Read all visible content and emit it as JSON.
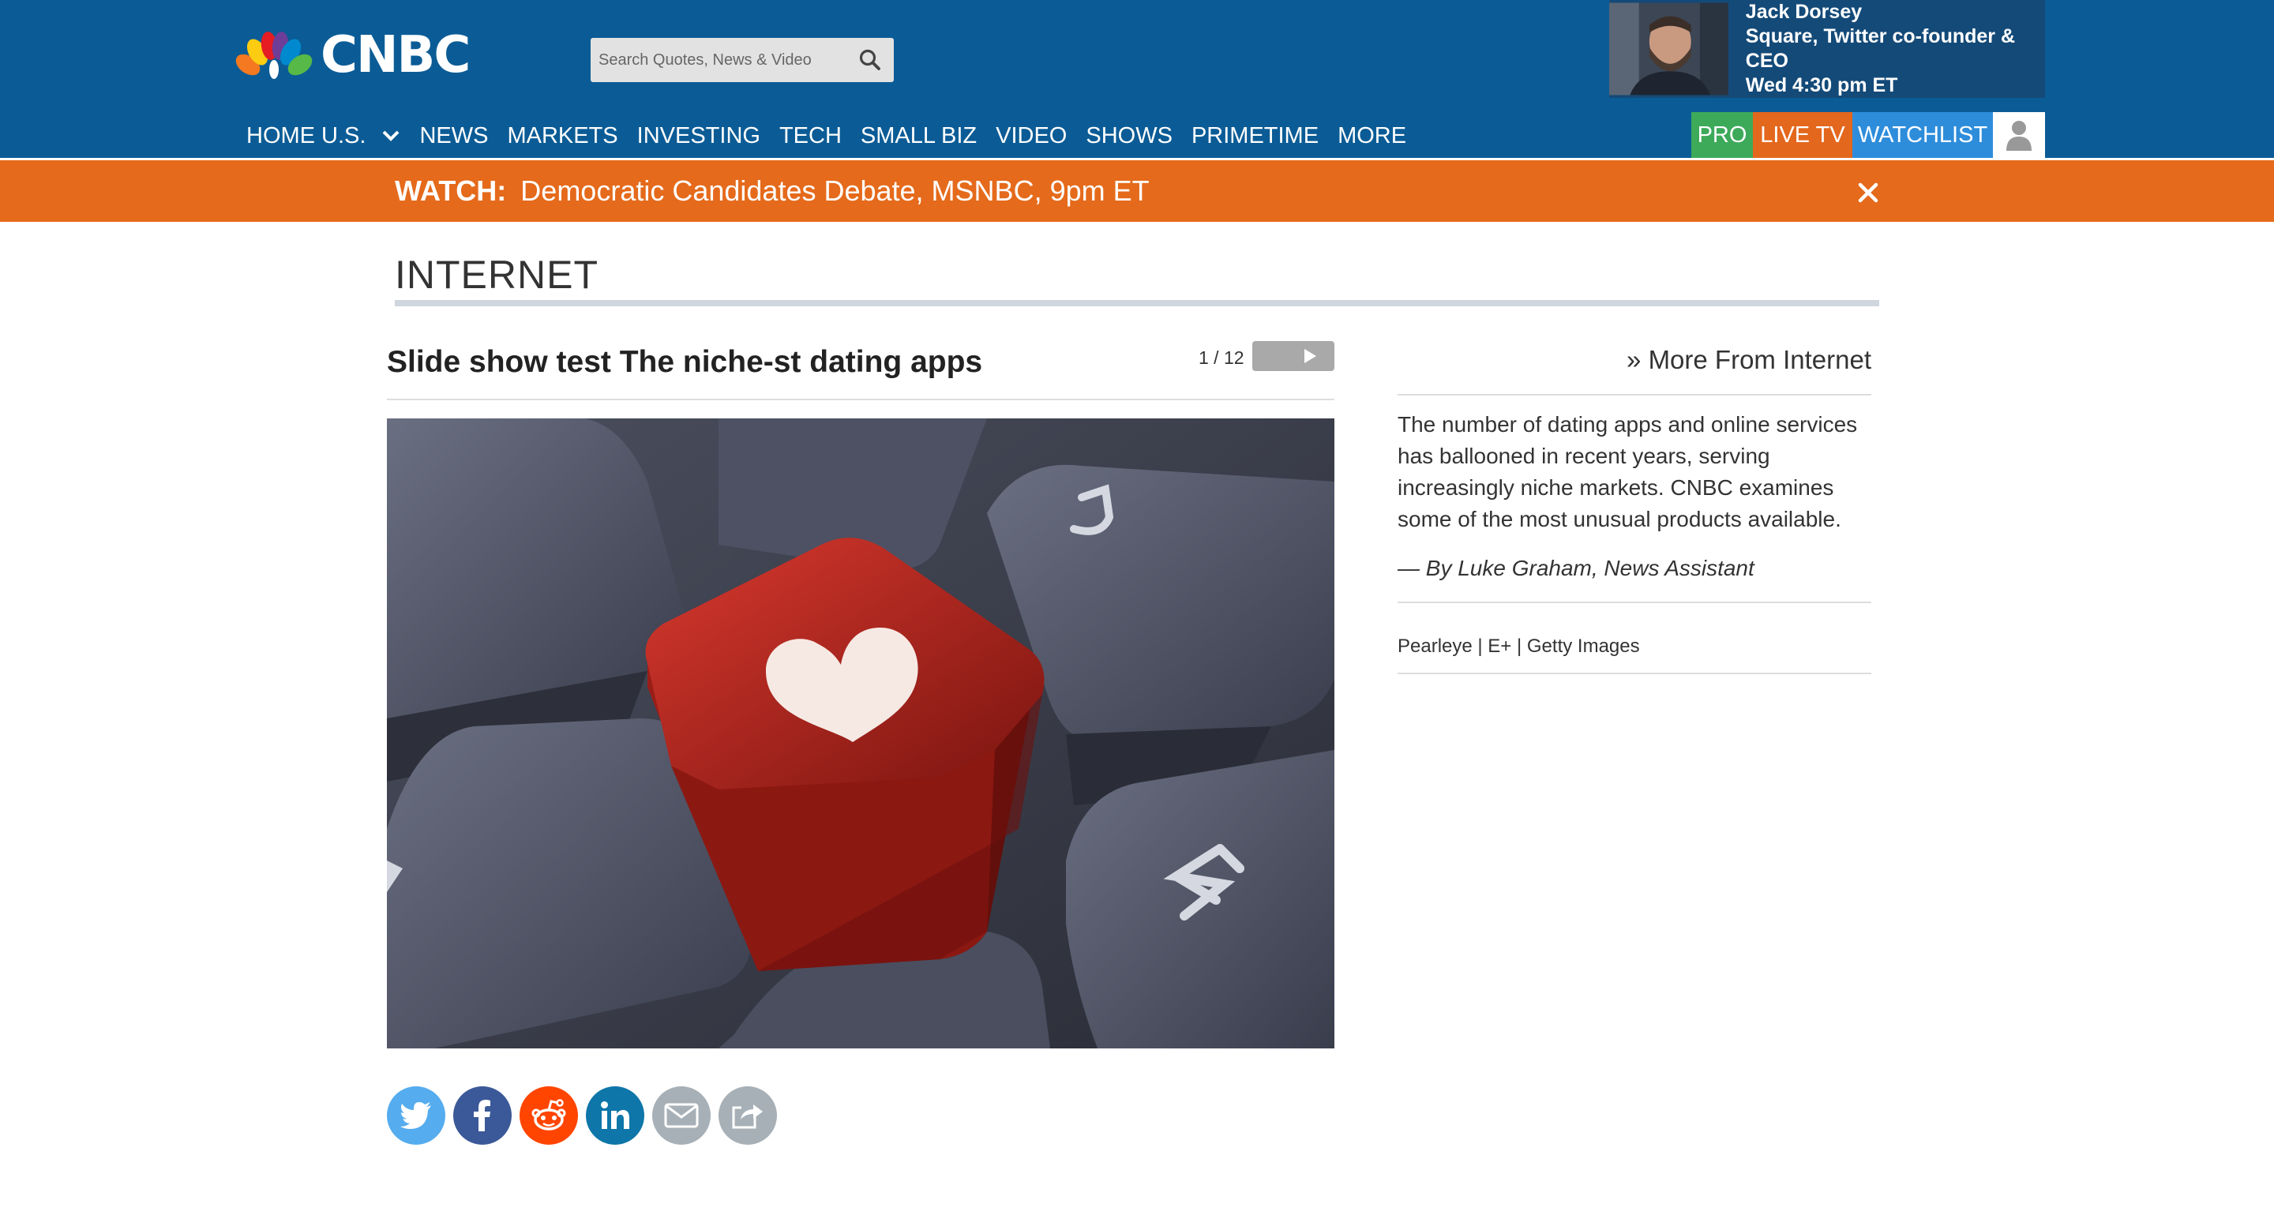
{
  "header": {
    "logo_text": "CNBC",
    "search": {
      "placeholder": "Search Quotes, News & Video"
    },
    "promo": {
      "name": "Jack Dorsey",
      "title": "Square, Twitter co-founder & CEO",
      "time": "Wed 4:30 pm ET"
    },
    "nav": [
      "HOME U.S.",
      "NEWS",
      "MARKETS",
      "INVESTING",
      "TECH",
      "SMALL BIZ",
      "VIDEO",
      "SHOWS",
      "PRIMETIME",
      "MORE"
    ],
    "buttons": {
      "pro": "PRO",
      "live_tv": "LIVE TV",
      "watchlist": "WATCHLIST"
    }
  },
  "banner": {
    "label": "WATCH:",
    "text": "Democratic Candidates Debate, MSNBC, 9pm ET"
  },
  "section": {
    "title": "INTERNET"
  },
  "slideshow": {
    "title": "Slide show test The niche-st dating apps",
    "counter": "1 / 12"
  },
  "rail": {
    "more_link": "» More From Internet",
    "description": "The number of dating apps and online services has ballooned in recent years, serving increasingly niche markets. CNBC examines some of the most unusual products available.",
    "byline": "— By Luke Graham, News Assistant",
    "credit": "Pearleye | E+ | Getty Images"
  },
  "share": [
    {
      "name": "twitter",
      "color": "#55acee"
    },
    {
      "name": "facebook",
      "color": "#3b5998"
    },
    {
      "name": "reddit",
      "color": "#ff4500"
    },
    {
      "name": "linkedin",
      "color": "#0e76a8"
    },
    {
      "name": "email",
      "color": "#a7b0b6"
    },
    {
      "name": "share",
      "color": "#a7b0b6"
    }
  ],
  "colors": {
    "header_blue": "#0b5c96",
    "banner_orange": "#e56a1b",
    "pro_green": "#3daa5a",
    "live_orange": "#e3671d",
    "watchlist_blue": "#2e8ddb"
  }
}
